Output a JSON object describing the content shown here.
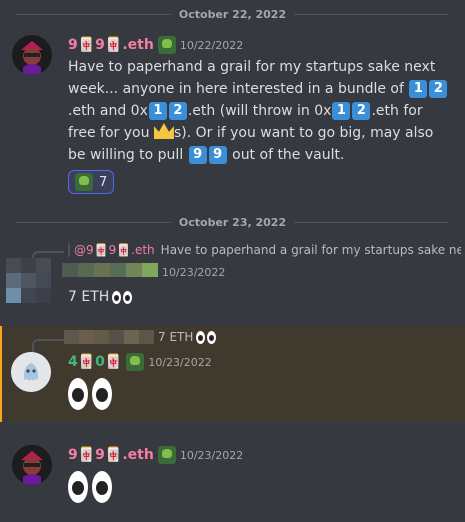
{
  "dividers": [
    "October 22, 2022",
    "October 23, 2022"
  ],
  "msg1": {
    "username": "9🀄9🀄.eth",
    "timestamp": "10/22/2022",
    "text_a": "Have to paperhand a grail for my startups sake next week... anyone in here interested in a bundle of ",
    "kc1": [
      "1",
      "2"
    ],
    "text_b": ".eth and 0x",
    "kc2": [
      "1",
      "2"
    ],
    "text_c": ".eth (will throw in 0x",
    "kc3": [
      "1",
      "2"
    ],
    "text_d": ".eth for free for you ",
    "text_e": "s). Or if you want to go big, may also be willing to pull ",
    "kc4": [
      "9",
      "9"
    ],
    "text_f": " out of the vault.",
    "reaction_count": "7"
  },
  "msg2": {
    "reply_name": "@9🀄9🀄.eth",
    "reply_text": "Have to paperhand a grail for my startups sake nex...",
    "timestamp": "10/23/2022",
    "text": "7 ETH"
  },
  "msg3": {
    "reply_text": "7 ETH",
    "username": "4🀄0🀄",
    "timestamp": "10/23/2022"
  },
  "msg4": {
    "username": "9🀄9🀄.eth",
    "timestamp": "10/23/2022"
  },
  "colors": {
    "background": "#36393f",
    "pink_name": "#f47fa4",
    "green_name": "#43b581",
    "highlight": "#40392d",
    "keycap": "#3a8fd8"
  }
}
